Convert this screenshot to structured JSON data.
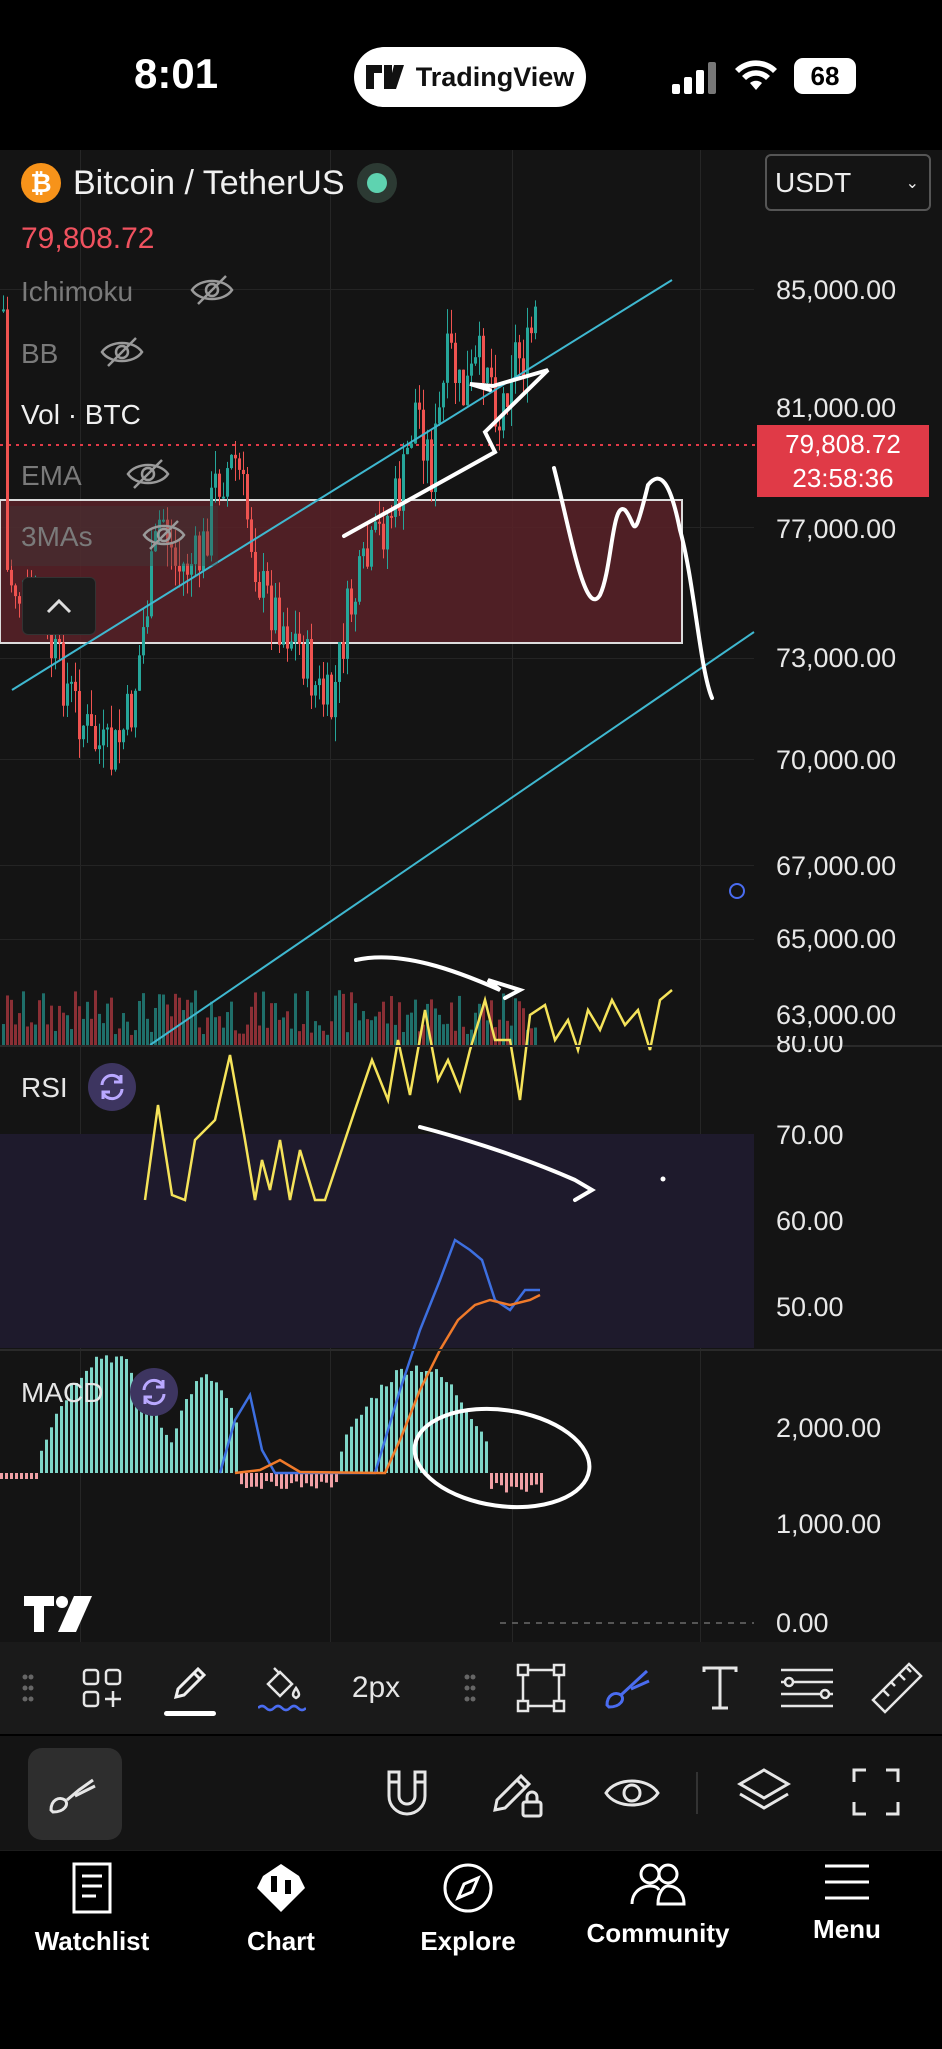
{
  "status_bar": {
    "time": "8:01",
    "app_pill": "TradingView",
    "battery": "68"
  },
  "chart": {
    "symbol_title": "Bitcoin / TetherUS",
    "symbol_logo": "₿",
    "last_price": "79,808.72",
    "currency": "USDT",
    "current_price_tag": "79,808.72",
    "countdown": "23:58:36",
    "price_axis": [
      "85,000.00",
      "81,000.00",
      "77,000.00",
      "73,000.00",
      "70,000.00",
      "67,000.00",
      "65,000.00",
      "63,000.00"
    ],
    "indicators": [
      {
        "label": "Ichimoku",
        "hidden": true
      },
      {
        "label": "BB",
        "hidden": true
      },
      {
        "label": "Vol · BTC",
        "hidden": false
      },
      {
        "label": "EMA",
        "hidden": true
      },
      {
        "label": "3MAs",
        "hidden": true
      }
    ],
    "colors": {
      "up": "#26a69a",
      "down": "#ef5350",
      "channel": "#3fb8d0",
      "zone": "#6b2a30",
      "rsi": "#f5e35a",
      "macd": "#3d6fe0",
      "signal": "#f07a2a"
    }
  },
  "rsi": {
    "title": "RSI",
    "axis": [
      "80.00",
      "70.00",
      "60.00",
      "50.00"
    ]
  },
  "macd": {
    "title": "MACD",
    "axis": [
      "2,000.00",
      "1,000.00",
      "0.00"
    ]
  },
  "draw_toolbar": {
    "stroke_size": "2px",
    "icons": [
      "drag-handle-icon",
      "add-objects-icon",
      "pen-icon",
      "fill-icon",
      "drag-handle-icon",
      "rectangle-icon",
      "brush-icon",
      "text-icon",
      "fib-icon",
      "ruler-icon"
    ]
  },
  "action_row": {
    "icons": [
      "brush-icon",
      "magnet-icon",
      "lock-drawing-icon",
      "eye-icon",
      "layers-icon",
      "fullscreen-icon"
    ]
  },
  "bottom_nav": [
    {
      "label": "Watchlist",
      "icon": "watchlist-icon"
    },
    {
      "label": "Chart",
      "icon": "chart-icon"
    },
    {
      "label": "Explore",
      "icon": "compass-icon"
    },
    {
      "label": "Community",
      "icon": "community-icon"
    },
    {
      "label": "Menu",
      "icon": "menu-icon"
    }
  ]
}
